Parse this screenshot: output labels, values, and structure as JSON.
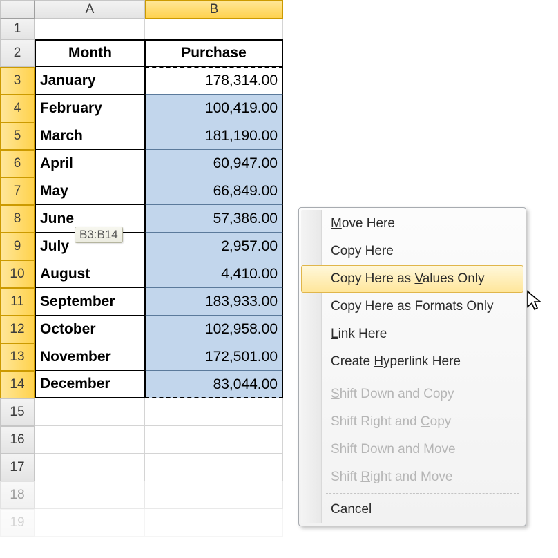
{
  "columns": [
    "A",
    "B"
  ],
  "row_numbers": [
    1,
    2,
    3,
    4,
    5,
    6,
    7,
    8,
    9,
    10,
    11,
    12,
    13,
    14,
    15,
    16,
    17,
    18,
    19
  ],
  "headers": {
    "a": "Month",
    "b": "Purchase"
  },
  "rows": [
    {
      "month": "January",
      "value": "178,314.00"
    },
    {
      "month": "February",
      "value": "100,419.00"
    },
    {
      "month": "March",
      "value": "181,190.00"
    },
    {
      "month": "April",
      "value": "60,947.00"
    },
    {
      "month": "May",
      "value": "66,849.00"
    },
    {
      "month": "June",
      "value": "57,386.00"
    },
    {
      "month": "July",
      "value": "2,957.00"
    },
    {
      "month": "August",
      "value": "4,410.00"
    },
    {
      "month": "September",
      "value": "183,933.00"
    },
    {
      "month": "October",
      "value": "102,958.00"
    },
    {
      "month": "November",
      "value": "172,501.00"
    },
    {
      "month": "December",
      "value": "83,044.00"
    }
  ],
  "tooltip": "B3:B14",
  "menu": {
    "move_here": {
      "pre": "",
      "u": "M",
      "post": "ove Here"
    },
    "copy_here": {
      "pre": "",
      "u": "C",
      "post": "opy Here"
    },
    "copy_values": {
      "pre": "Copy Here as ",
      "u": "V",
      "post": "alues Only"
    },
    "copy_formats": {
      "pre": "Copy Here as ",
      "u": "F",
      "post": "ormats Only"
    },
    "link_here": {
      "pre": "",
      "u": "L",
      "post": "ink Here"
    },
    "create_hyperlink": {
      "pre": "Create ",
      "u": "H",
      "post": "yperlink Here"
    },
    "shift_down_copy": {
      "pre": "",
      "u": "S",
      "post": "hift Down and Copy"
    },
    "shift_right_copy": {
      "pre": "Shift Right and ",
      "u": "C",
      "post": "opy"
    },
    "shift_down_move": {
      "pre": "Shift ",
      "u": "D",
      "post": "own and Move"
    },
    "shift_right_move": {
      "pre": "Shift ",
      "u": "R",
      "post": "ight and Move"
    },
    "cancel": {
      "pre": "C",
      "u": "a",
      "post": "ncel"
    }
  }
}
